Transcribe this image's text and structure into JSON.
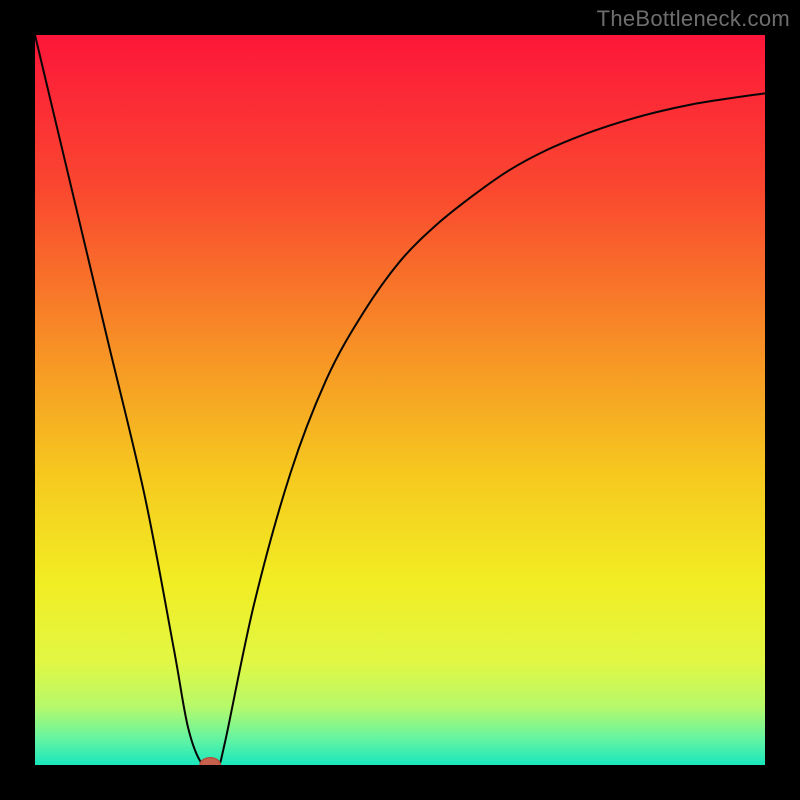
{
  "attribution": "TheBottleneck.com",
  "colors": {
    "frame": "#000000",
    "curve": "#060606",
    "marker_fill": "#c7604d",
    "marker_stroke": "#b84b3b"
  },
  "gradient_stops": [
    {
      "offset": 0.0,
      "color": "#fd163a"
    },
    {
      "offset": 0.22,
      "color": "#fa4a2f"
    },
    {
      "offset": 0.42,
      "color": "#f78e26"
    },
    {
      "offset": 0.6,
      "color": "#f6c81f"
    },
    {
      "offset": 0.75,
      "color": "#f1ed23"
    },
    {
      "offset": 0.86,
      "color": "#e1f744"
    },
    {
      "offset": 0.92,
      "color": "#b6f96a"
    },
    {
      "offset": 0.965,
      "color": "#62f4a3"
    },
    {
      "offset": 1.0,
      "color": "#19e7bd"
    }
  ],
  "chart_data": {
    "type": "line",
    "title": "",
    "xlabel": "",
    "ylabel": "",
    "xlim": [
      0,
      100
    ],
    "ylim": [
      0,
      100
    ],
    "grid": false,
    "series": [
      {
        "name": "curve",
        "x": [
          0,
          5,
          10,
          15,
          19,
          21,
          23,
          25,
          26,
          30,
          35,
          40,
          45,
          50,
          55,
          60,
          65,
          70,
          75,
          80,
          85,
          90,
          95,
          100
        ],
        "y": [
          100,
          79,
          58,
          37,
          16,
          5,
          0,
          0,
          3,
          22,
          40,
          53,
          62,
          69,
          74,
          78,
          81.5,
          84.2,
          86.3,
          88,
          89.4,
          90.5,
          91.3,
          92
        ]
      }
    ],
    "marker": {
      "x": 24,
      "y": 0,
      "rx": 1.4,
      "ry": 1.0
    },
    "legend": false
  }
}
